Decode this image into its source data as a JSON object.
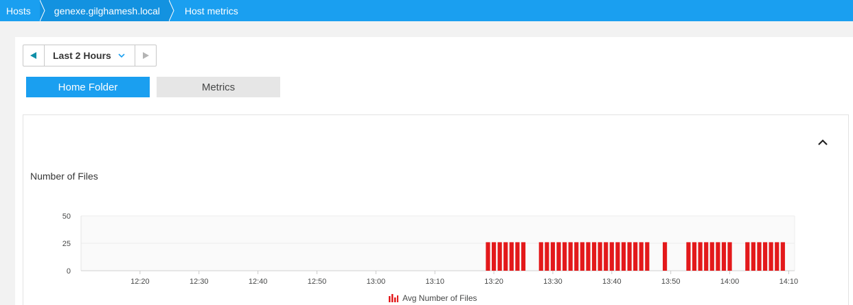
{
  "breadcrumb": {
    "items": [
      {
        "label": "Hosts"
      },
      {
        "label": "genexe.gilghamesh.local"
      },
      {
        "label": "Host metrics"
      }
    ]
  },
  "timeframe": {
    "label": "Last 2 Hours",
    "prev_icon": "triangle-left-icon",
    "next_icon": "triangle-right-icon"
  },
  "tabs": [
    {
      "label": "Home Folder",
      "active": true
    },
    {
      "label": "Metrics",
      "active": false
    }
  ],
  "colors": {
    "accent": "#1a9ff0",
    "bar": "#e3191b",
    "tab_inactive": "#e6e6e6"
  },
  "chart": {
    "collapse_icon": "chevron-up-icon",
    "legend_icon": "bar-chart-icon"
  },
  "chart_data": {
    "type": "bar",
    "title": "Number of Files",
    "xlabel": "",
    "ylabel": "",
    "ylim": [
      0,
      50
    ],
    "yticks": [
      "0",
      "25",
      "50"
    ],
    "xticks": [
      "12:20",
      "12:30",
      "12:40",
      "12:50",
      "13:00",
      "13:10",
      "13:20",
      "13:30",
      "13:40",
      "13:50",
      "14:00",
      "14:10"
    ],
    "xrange": [
      "12:10",
      "14:11"
    ],
    "grid": true,
    "legend_position": "bottom",
    "series": [
      {
        "name": "Avg Number of Files",
        "color": "#e3191b",
        "x": [
          "13:19",
          "13:20",
          "13:21",
          "13:22",
          "13:23",
          "13:24",
          "13:25",
          "13:28",
          "13:29",
          "13:30",
          "13:31",
          "13:32",
          "13:33",
          "13:34",
          "13:35",
          "13:36",
          "13:37",
          "13:38",
          "13:39",
          "13:40",
          "13:41",
          "13:42",
          "13:43",
          "13:44",
          "13:45",
          "13:46",
          "13:49",
          "13:53",
          "13:54",
          "13:55",
          "13:56",
          "13:57",
          "13:58",
          "13:59",
          "14:00",
          "14:03",
          "14:04",
          "14:05",
          "14:06",
          "14:07",
          "14:08",
          "14:09"
        ],
        "values": [
          26,
          26,
          26,
          26,
          26,
          26,
          26,
          26,
          26,
          26,
          26,
          26,
          26,
          26,
          26,
          26,
          26,
          26,
          26,
          26,
          26,
          26,
          26,
          26,
          26,
          26,
          26,
          26,
          26,
          26,
          26,
          26,
          26,
          26,
          26,
          26,
          26,
          26,
          26,
          26,
          26,
          26
        ]
      }
    ]
  }
}
